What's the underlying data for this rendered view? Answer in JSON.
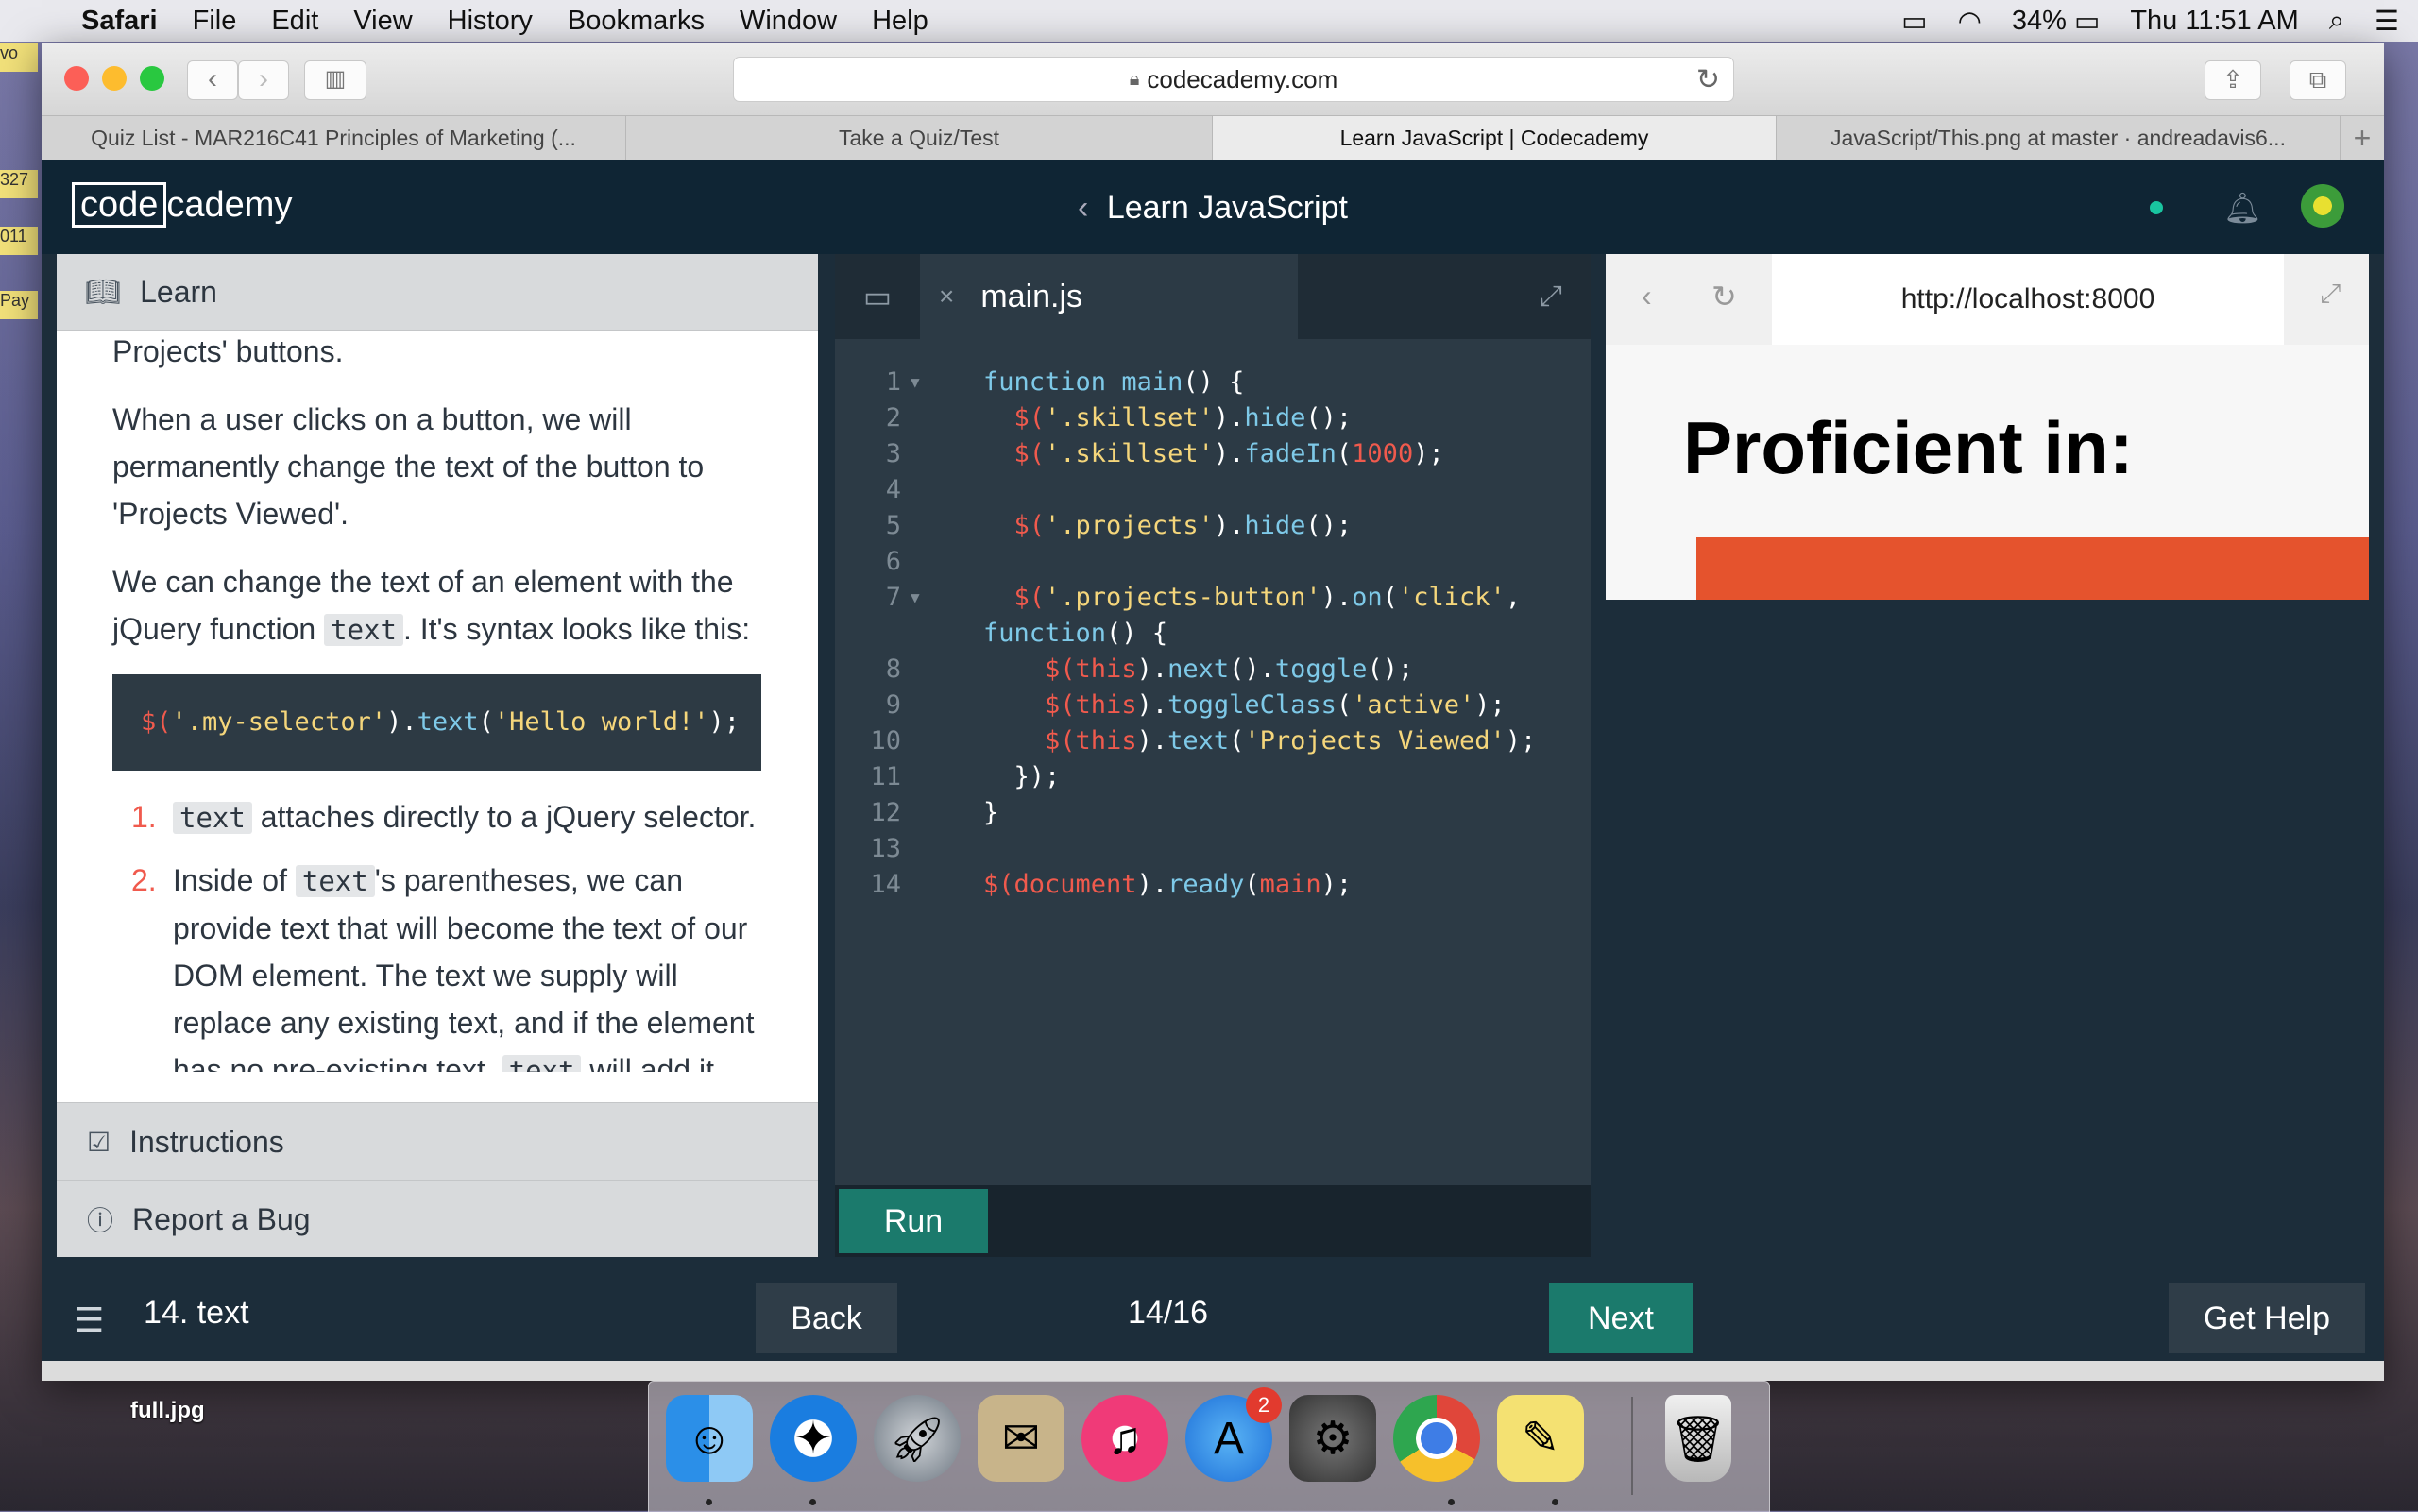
{
  "menubar": {
    "app": "Safari",
    "items": [
      "File",
      "Edit",
      "View",
      "History",
      "Bookmarks",
      "Window",
      "Help"
    ],
    "battery": "34%",
    "clock": "Thu 11:51 AM"
  },
  "desktop_stickies": [
    "vo",
    "327",
    "011",
    "Pay"
  ],
  "browser": {
    "url": "codecademy.com",
    "tabs": [
      "Quiz List - MAR216C41 Principles of Marketing (...",
      "Take a Quiz/Test",
      "Learn JavaScript | Codecademy",
      "JavaScript/This.png at master · andreadavis6..."
    ],
    "new_tab": "+"
  },
  "app": {
    "logo_left": "code",
    "logo_right": "cademy",
    "course_title": "Learn JavaScript",
    "learn_header": "Learn",
    "learn": {
      "p0": "Projects' buttons.",
      "p1": "When a user clicks on a button, we will permanently change the text of the button to 'Projects Viewed'.",
      "p2_a": "We can change the text of an element with the jQuery function ",
      "p2_code": "text",
      "p2_b": ". It's syntax looks like this:",
      "codeblock": {
        "t1": "$(",
        "t2": "'.my-selector'",
        "t3": ").",
        "t4": "text",
        "t5": "(",
        "t6": "'Hello world!'",
        "t7": ");"
      },
      "li1_num": "1.",
      "li1_code": "text",
      "li1_text": " attaches directly to a jQuery selector.",
      "li2_num": "2.",
      "li2_a": "Inside of ",
      "li2_code": "text",
      "li2_b": "'s parentheses, we can provide text that will become the text of our DOM element. The text we supply will replace any existing text, and if the element has no pre-existing text, ",
      "li2_code2": "text",
      "li2_c": " will add it."
    },
    "instructions_label": "Instructions",
    "report_label": "Report a Bug",
    "editor": {
      "filename": "main.js",
      "line_numbers": [
        "1",
        "2",
        "3",
        "4",
        "5",
        "6",
        "7",
        "",
        "8",
        "9",
        "10",
        "11",
        "12",
        "13",
        "14"
      ],
      "run_label": "Run"
    },
    "preview": {
      "url": "http://localhost:8000",
      "heading": "Proficient in:"
    },
    "bottom": {
      "lesson": "14. text",
      "back": "Back",
      "progress": "14/16",
      "next": "Next",
      "help": "Get Help"
    }
  },
  "desktop": {
    "file_label": "full.jpg",
    "dock_badge": "2"
  }
}
